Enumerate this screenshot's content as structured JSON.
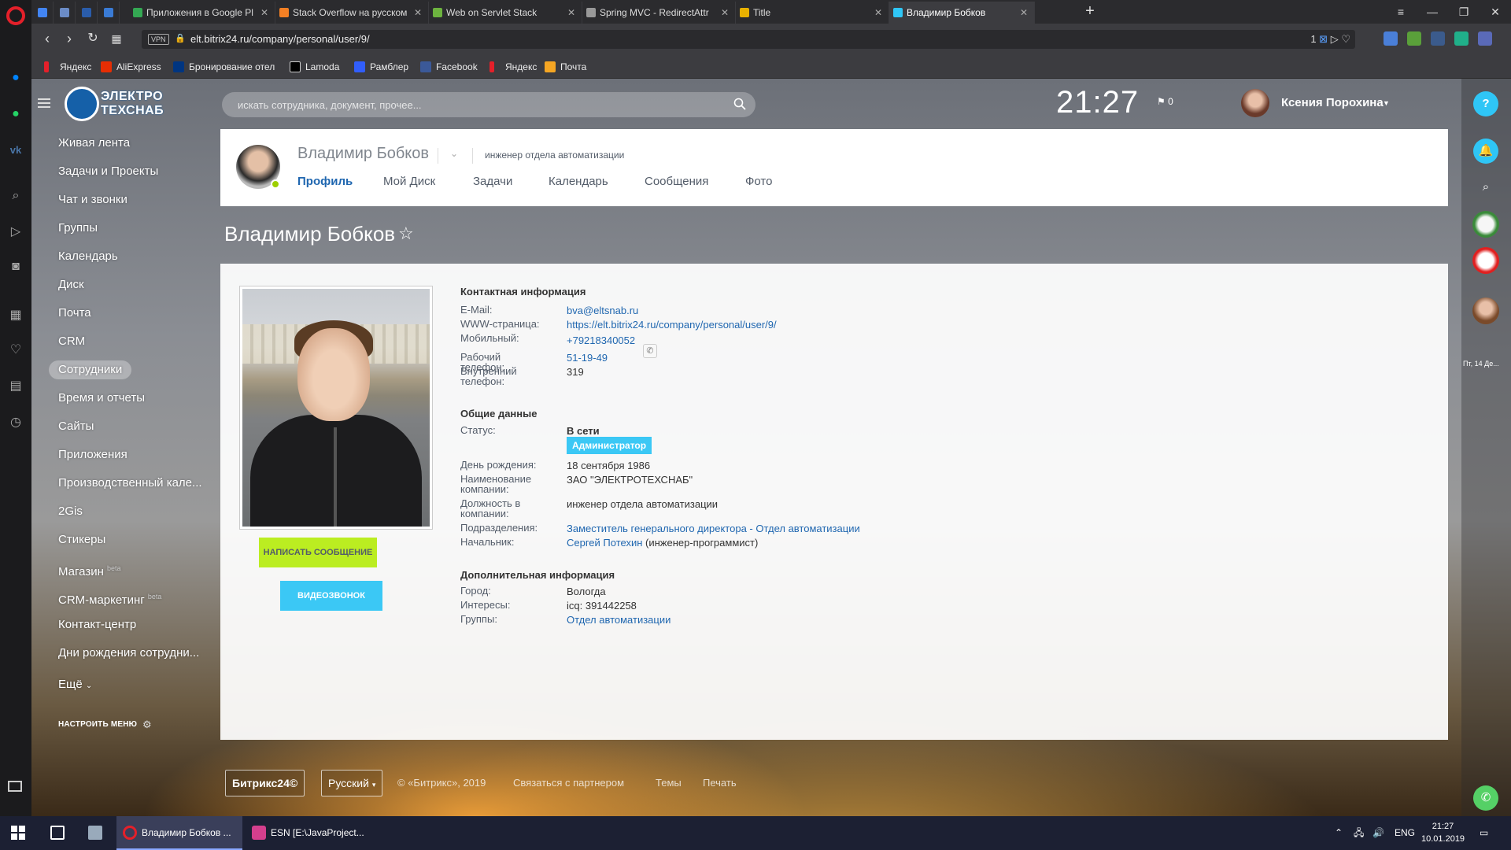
{
  "browser": {
    "tabs": [
      {
        "label": "Приложения в Google Pl",
        "color": "#34a853"
      },
      {
        "label": "Stack Overflow на русском",
        "color": "#f48024"
      },
      {
        "label": "Web on Servlet Stack",
        "color": "#6db33f"
      },
      {
        "label": "Spring MVC - RedirectAttr",
        "color": "#999999"
      },
      {
        "label": "Title",
        "color": "#e8b100"
      },
      {
        "label": "Владимир Бобков",
        "color": "#2fc6f6"
      }
    ],
    "url": "elt.bitrix24.ru/company/personal/user/9/",
    "vpn_label": "VPN",
    "url_right_counter": "1",
    "bookmarks": [
      {
        "label": "Яндекс",
        "color": "#e4202a"
      },
      {
        "label": "AliExpress",
        "color": "#e62e04"
      },
      {
        "label": "Бронирование отел",
        "color": "#003580"
      },
      {
        "label": "Lamoda",
        "color": "#000000"
      },
      {
        "label": "Рамблер",
        "color": "#315efb"
      },
      {
        "label": "Facebook",
        "color": "#3b5998"
      },
      {
        "label": "Яндекс",
        "color": "#e4202a"
      },
      {
        "label": "Почта",
        "color": "#f5a623"
      }
    ]
  },
  "portal": {
    "logo_line1": "ЭЛЕКТРО",
    "logo_line2": "ТЕХСНАБ",
    "search_placeholder": "искать сотрудника, документ, прочее...",
    "clock": "21:27",
    "flag_count": "0",
    "current_user": "Ксения Порохина",
    "help_label": "?",
    "menu": [
      "Живая лента",
      "Задачи и Проекты",
      "Чат и звонки",
      "Группы",
      "Календарь",
      "Диск",
      "Почта",
      "CRM",
      "Сотрудники",
      "Время и отчеты",
      "Сайты",
      "Приложения",
      "Производственный кале...",
      "2Gis",
      "Стикеры",
      "Магазин",
      "CRM-маркетинг",
      "Контакт-центр",
      "Дни рождения сотрудни...",
      "Ещё"
    ],
    "menu_active": "Сотрудники",
    "beta_label": "beta",
    "menu_settings": "НАСТРОИТЬ МЕНЮ",
    "right_date": "Пт, 14 Де..."
  },
  "profile": {
    "name": "Владимир Бобков",
    "position": "инженер отдела автоматизации",
    "tabs": [
      "Профиль",
      "Мой Диск",
      "Задачи",
      "Календарь",
      "Сообщения",
      "Фото"
    ],
    "btn_message": "НАПИСАТЬ СООБЩЕНИЕ",
    "btn_video": "ВИДЕОЗВОНОК",
    "contact": {
      "title": "Контактная информация",
      "email_label": "E-Mail:",
      "email": "bva@eltsnab.ru",
      "www_label": "WWW-страница:",
      "www": "https://elt.bitrix24.ru/company/personal/user/9/",
      "mobile_label": "Мобильный:",
      "mobile": "+79218340052",
      "work_phone_label": "Рабочий телефон:",
      "work_phone": "51-19-49",
      "internal_label": "Внутренний телефон:",
      "internal": "319"
    },
    "general": {
      "title": "Общие данные",
      "status_label": "Статус:",
      "status": "В сети",
      "role_badge": "Администратор",
      "birthday_label": "День рождения:",
      "birthday": "18 сентября 1986",
      "company_label": "Наименование компании:",
      "company": "ЗАО \"ЭЛЕКТРОТЕХСНАБ\"",
      "job_label": "Должность в компании:",
      "job": "инженер отдела автоматизации",
      "dept_label": "Подразделения:",
      "dept": "Заместитель генерального директора - Отдел автоматизации",
      "boss_label": "Начальник:",
      "boss": "Сергей Потехин",
      "boss_role": "(инженер-программист)"
    },
    "extra": {
      "title": "Дополнительная информация",
      "city_label": "Город:",
      "city": "Вологда",
      "interests_label": "Интересы:",
      "interests": "icq: 391442258",
      "groups_label": "Группы:",
      "groups": "Отдел автоматизации"
    }
  },
  "footer": {
    "brand": "Битрикс24©",
    "language": "Русский",
    "copyright": "© «Битрикс», 2019",
    "links": [
      "Связаться с партнером",
      "Темы",
      "Печать"
    ]
  },
  "taskbar": {
    "items": [
      {
        "label": "Владимир Бобков ...",
        "color": "#e4202a"
      },
      {
        "label": "ESN [E:\\JavaProject...",
        "color": "#d43f8d"
      }
    ],
    "lang": "ENG",
    "time": "21:27",
    "date": "10.01.2019"
  }
}
